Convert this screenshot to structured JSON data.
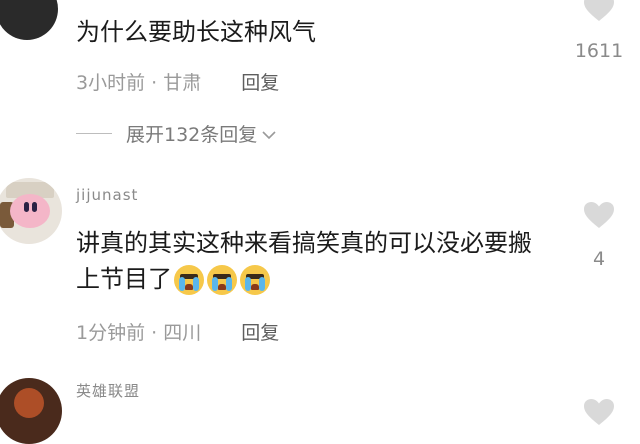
{
  "comments": [
    {
      "text": "为什么要助长这种风气",
      "time": "3小时前",
      "location": "甘肃",
      "reply_label": "回复",
      "likes": "1611"
    },
    {
      "username": "jijunast",
      "text": "讲真的其实这种来看搞笑真的可以没必要搬上节目了",
      "emoji": [
        "loudly-crying-face",
        "loudly-crying-face",
        "loudly-crying-face"
      ],
      "time": "1分钟前",
      "location": "四川",
      "reply_label": "回复",
      "likes": "4"
    },
    {
      "username": "英雄联盟"
    }
  ],
  "expand_replies_label": "展开132条回复",
  "colors": {
    "text": "#1b1b1b",
    "meta": "#9a9a9a",
    "heart": "#d9d9d9",
    "emoji_face": "#f6c84a",
    "emoji_tears": "#5ab6ec"
  }
}
